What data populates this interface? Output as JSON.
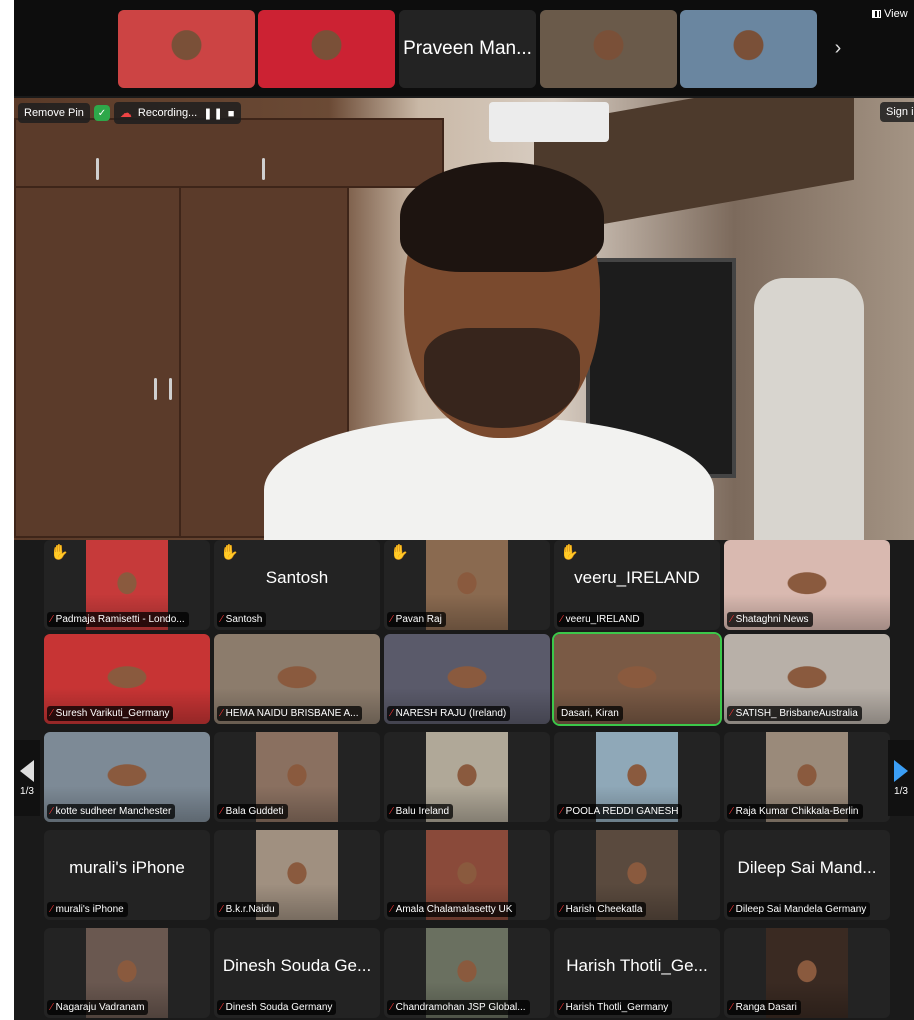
{
  "top_strip": {
    "tiles": [
      {
        "name": "",
        "kind": "photo",
        "color": "#c44"
      },
      {
        "name": "",
        "kind": "photo",
        "color": "#c23"
      },
      {
        "name": "Praveen Man...",
        "kind": "name"
      },
      {
        "name": "",
        "kind": "photo",
        "color": "#6a5a4a"
      },
      {
        "name": "",
        "kind": "photo",
        "color": "#6a86a0"
      }
    ],
    "next_label": "›",
    "view_label": "View"
  },
  "speaker": {
    "remove_pin": "Remove Pin",
    "recording": "Recording...",
    "recording_controls": "❚❚ ■",
    "sign_in": "Sign in"
  },
  "gallery": {
    "page_left": "1/3",
    "page_right": "1/3",
    "tiles": [
      {
        "label": "Padmaja Ramisetti - Londo...",
        "hand": true,
        "photo": "center",
        "color": "#c63a3a"
      },
      {
        "label": "Santosh",
        "hand": true,
        "bigname": "Santosh"
      },
      {
        "label": "Pavan Raj",
        "hand": true,
        "photo": "center",
        "color": "#8a6a50"
      },
      {
        "label": "veeru_IRELAND",
        "hand": true,
        "bigname": "veeru_IRELAND"
      },
      {
        "label": "Shataghni News",
        "photo": "full",
        "color": "#d9b9b0"
      },
      {
        "label": "Suresh Varikuti_Germany",
        "photo": "full",
        "color": "#c73434"
      },
      {
        "label": "HEMA NAIDU BRISBANE A...",
        "photo": "full",
        "color": "#8c7c6c"
      },
      {
        "label": "NARESH RAJU (Ireland)",
        "photo": "full",
        "color": "#5a5a6a"
      },
      {
        "label": "Dasari, Kiran",
        "photo": "full",
        "color": "#7a5a45",
        "active": true
      },
      {
        "label": "SATISH_ BrisbaneAustralia",
        "photo": "full",
        "color": "#b8b0a8"
      },
      {
        "label": "kotte sudheer Manchester",
        "photo": "full",
        "color": "#7d8a96"
      },
      {
        "label": "Bala Guddeti",
        "photo": "center",
        "color": "#8a7060"
      },
      {
        "label": "Balu Ireland",
        "photo": "center",
        "color": "#b0a898"
      },
      {
        "label": "POOLA REDDI GANESH",
        "photo": "center",
        "color": "#8fa8b8"
      },
      {
        "label": "Raja Kumar Chikkala-Berlin",
        "photo": "center",
        "color": "#9a8a7a"
      },
      {
        "label": "murali's iPhone",
        "bigname": "murali's iPhone"
      },
      {
        "label": "B.k.r.Naidu",
        "photo": "center",
        "color": "#a09080"
      },
      {
        "label": "Amala Chalamalasetty UK",
        "photo": "center",
        "color": "#8a4a3a"
      },
      {
        "label": "Harish Cheekatla",
        "photo": "center",
        "color": "#5a4a3e"
      },
      {
        "label": "Dileep Sai Mandela Germany",
        "bigname": "Dileep Sai Mand..."
      },
      {
        "label": "Nagaraju Vadranam",
        "photo": "center",
        "color": "#6a5850"
      },
      {
        "label": "Dinesh Souda Germany",
        "bigname": "Dinesh Souda Ge..."
      },
      {
        "label": "Chandramohan JSP Global...",
        "photo": "center",
        "color": "#6a7060"
      },
      {
        "label": "Harish Thotli_Germany",
        "bigname": "Harish Thotli_Ge..."
      },
      {
        "label": "Ranga Dasari",
        "photo": "center",
        "color": "#3a2a22"
      }
    ]
  }
}
